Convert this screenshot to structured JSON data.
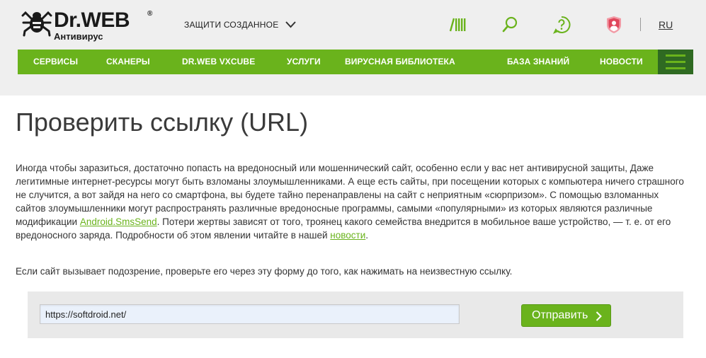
{
  "header": {
    "logo": {
      "brand": "Dr.WEB",
      "reg_mark": "®",
      "subtitle": "Антивирус"
    },
    "protect_menu_label": "ЗАЩИТИ СОЗДАННОЕ",
    "icons": [
      "barcode-icon",
      "search-icon",
      "help-icon",
      "user-shield-icon"
    ],
    "language": "RU"
  },
  "nav": {
    "items": [
      {
        "label": "СЕРВИСЫ"
      },
      {
        "label": "СКАНЕРЫ"
      },
      {
        "label": "DR.WEB VXCUBE"
      },
      {
        "label": "УСЛУГИ"
      },
      {
        "label": "ВИРУСНАЯ БИБЛИОТЕКА"
      },
      {
        "label": "БАЗА ЗНАНИЙ"
      },
      {
        "label": "НОВОСТИ"
      }
    ],
    "menu_icon": "hamburger-icon"
  },
  "page": {
    "title": "Проверить ссылку (URL)",
    "intro": {
      "part1": "Иногда чтобы заразиться, достаточно попасть на вредоносный или мошеннический сайт, особенно если у вас нет антивирусной защиты, Даже легитимные интернет-ресурсы могут быть взломаны злоумышленниками. А еще есть сайты, при посещении которых с компьютера ничего страшного не случится, а вот зайдя на него со смартфона, вы будете тайно перенаправлены на сайт с неприятным «сюрпризом». С помощью взломанных сайтов злоумышленники могут распространять различные вредоносные программы, самыми «популярными» из которых являются различные модификации ",
      "link1": "Android.SmsSend",
      "part2": ". Потери жертвы зависят от того, троянец какого семейства внедрится в мобильное ваше устройство, — т. е. от его вредоносного заряда. Подробности об этом явлении читайте в нашей ",
      "link2": "новости",
      "part3": "."
    },
    "hint": "Если сайт вызывает подозрение, проверьте его через эту форму до того, как нажимать на неизвестную ссылку."
  },
  "form": {
    "url_value": "https://softdroid.net/",
    "submit_label": "Отправить"
  },
  "colors": {
    "accent": "#6ab31c",
    "accent_dark": "#2f6a22",
    "header_bg": "#efefef",
    "form_bg": "#e9e9e9"
  }
}
